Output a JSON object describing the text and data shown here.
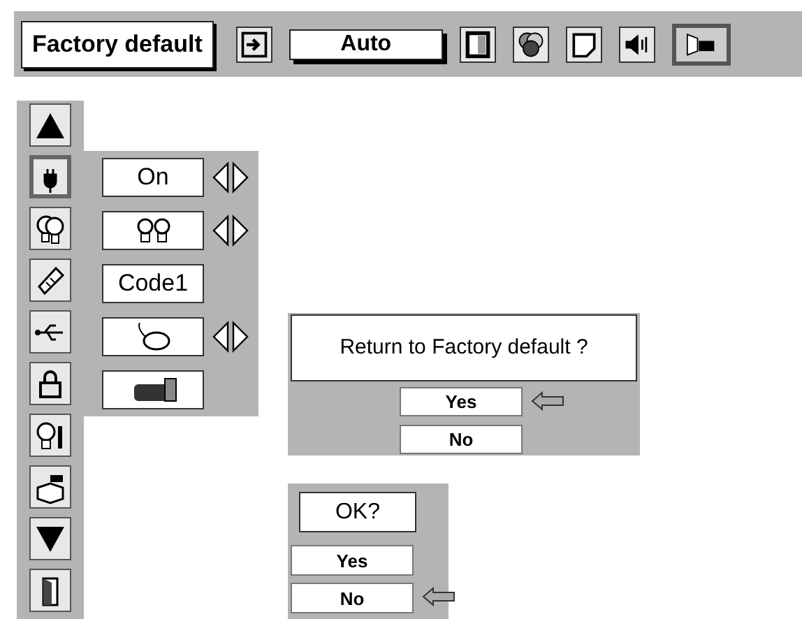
{
  "toolbar": {
    "title": "Factory default",
    "field": "Auto",
    "buttons": [
      {
        "selected": false
      },
      {
        "selected": false
      },
      {
        "selected": false
      },
      {
        "selected": false
      },
      {
        "selected": false
      },
      {
        "selected": true
      }
    ]
  },
  "menu_items": [
    {
      "selected": false
    },
    {
      "selected": true
    },
    {
      "selected": false
    },
    {
      "selected": false
    },
    {
      "selected": false
    },
    {
      "selected": false
    },
    {
      "selected": false
    },
    {
      "selected": false
    },
    {
      "selected": false
    },
    {
      "selected": false
    }
  ],
  "settings": [
    {
      "kind": "text",
      "value": "On",
      "adjustable": true
    },
    {
      "kind": "icon",
      "adjustable": true
    },
    {
      "kind": "text",
      "value": "Code1",
      "adjustable": false
    },
    {
      "kind": "icon",
      "adjustable": true
    },
    {
      "kind": "icon",
      "adjustable": false
    }
  ],
  "confirm_dialog": {
    "message": "Return to Factory default ?",
    "options": [
      {
        "label": "Yes",
        "selected": true
      },
      {
        "label": "No",
        "selected": false
      }
    ]
  },
  "ok_dialog": {
    "message": "OK?",
    "options": [
      {
        "label": "Yes",
        "selected": false
      },
      {
        "label": "No",
        "selected": true
      }
    ]
  }
}
